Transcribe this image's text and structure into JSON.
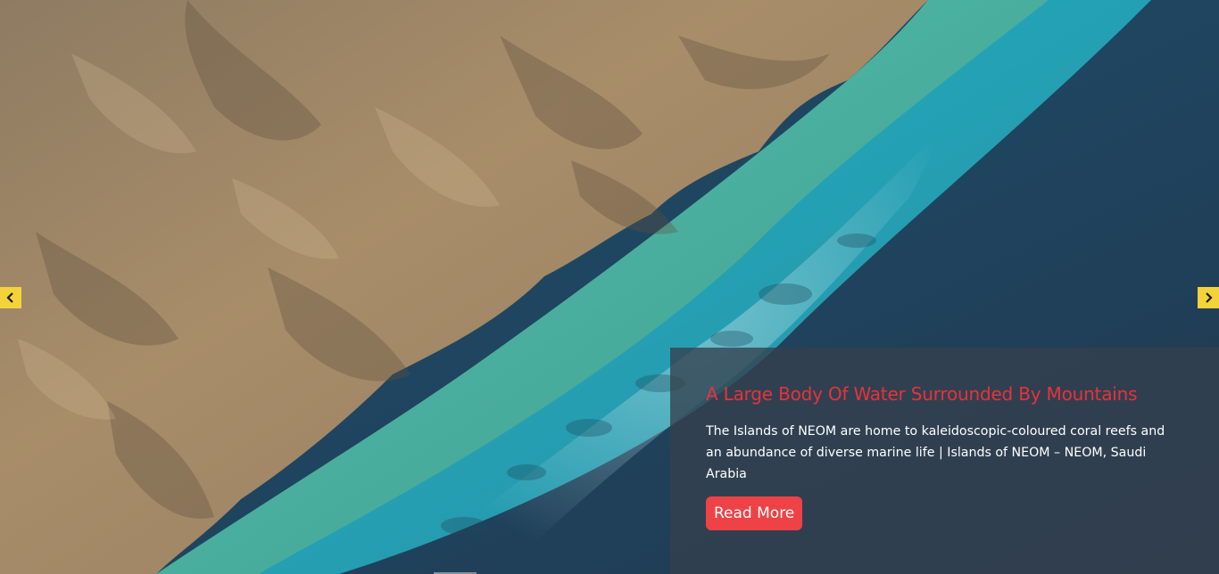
{
  "slide": {
    "title": "A Large Body Of Water Surrounded By Mountains",
    "description": "The Islands of NEOM are home to kaleidoscopic-coloured coral reefs and an abundance of diverse marine life | Islands of NEOM – NEOM, Saudi Arabia",
    "button_label": "Read More"
  },
  "navigation": {
    "prev_icon": "chevron-left-icon",
    "next_icon": "chevron-right-icon"
  },
  "colors": {
    "arrow_bg": "#f4d33a",
    "title": "#e8323a",
    "button_bg": "#ee4246",
    "caption_bg": "#34404e"
  },
  "image": {
    "alt": "A Large Body Of Water Surrounded By Mountains"
  }
}
